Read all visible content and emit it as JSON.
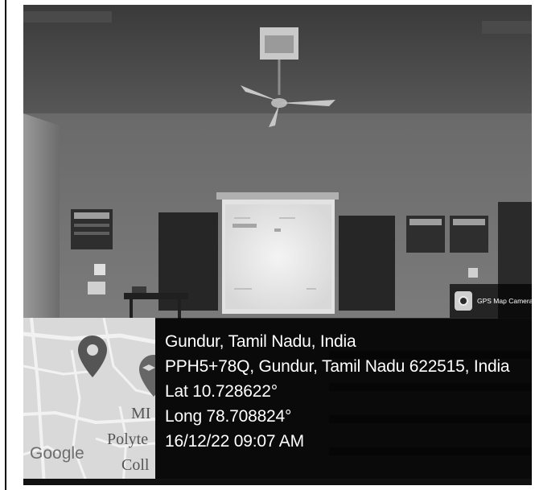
{
  "overlay": {
    "app_badge_label": "GPS Map Camera",
    "app_badge_icon": "camera-icon",
    "location_title": "Gundur, Tamil Nadu, India",
    "address": "PPH5+78Q, Gundur, Tamil Nadu 622515, India",
    "latitude": "Lat 10.728622°",
    "longitude": "Long 78.708824°",
    "datetime": "16/12/22 09:07 AM"
  },
  "map": {
    "provider_logo": "Google",
    "place_label_line1": "MI",
    "place_label_line2": "Polyte",
    "place_label_line3": "Coll",
    "primary_pin_icon": "map-pin-icon",
    "secondary_pin_icon": "map-pin-icon"
  },
  "colors": {
    "overlay_bg": "#000000",
    "overlay_text": "#ffffff",
    "map_bg": "#d9d9d9"
  }
}
